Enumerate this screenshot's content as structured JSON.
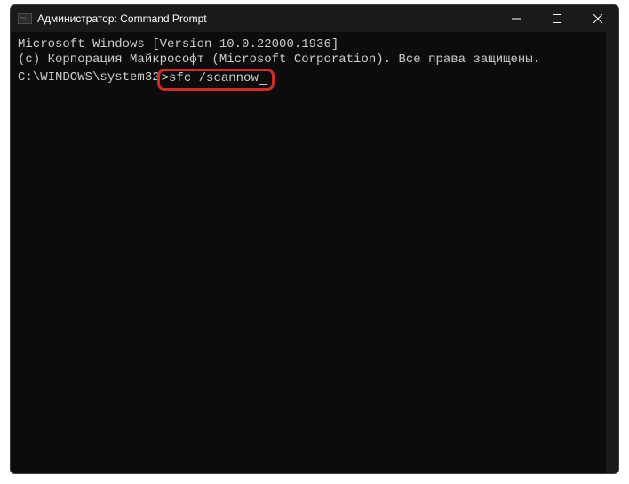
{
  "window": {
    "title": "Администратор: Command Prompt"
  },
  "terminal": {
    "line1": "Microsoft Windows [Version 10.0.22000.1936]",
    "line2": "(c) Корпорация Майкрософт (Microsoft Corporation). Все права защищены.",
    "blank": "",
    "prompt_prefix": "C:\\WINDOWS\\system32",
    "prompt_highlighted": ">sfc /scannow"
  },
  "colors": {
    "highlight_border": "#d62828",
    "terminal_bg": "#0c0c0c",
    "titlebar_bg": "#1a1a1a",
    "text": "#cccccc"
  }
}
